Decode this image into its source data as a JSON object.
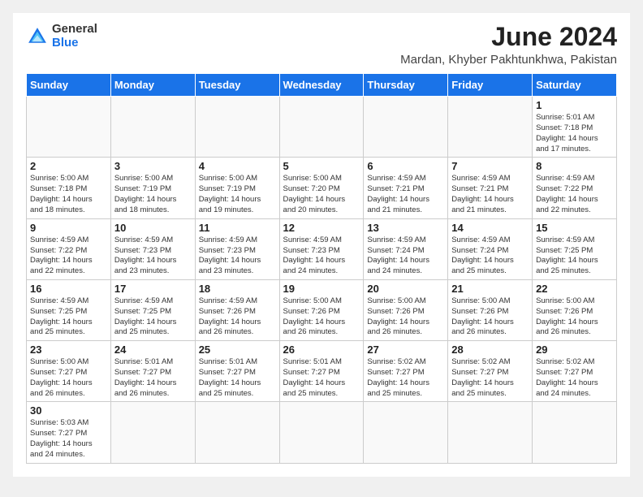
{
  "logo": {
    "line1": "General",
    "line2": "Blue"
  },
  "title": "June 2024",
  "location": "Mardan, Khyber Pakhtunkhwa, Pakistan",
  "weekdays": [
    "Sunday",
    "Monday",
    "Tuesday",
    "Wednesday",
    "Thursday",
    "Friday",
    "Saturday"
  ],
  "weeks": [
    [
      {
        "day": "",
        "info": ""
      },
      {
        "day": "",
        "info": ""
      },
      {
        "day": "",
        "info": ""
      },
      {
        "day": "",
        "info": ""
      },
      {
        "day": "",
        "info": ""
      },
      {
        "day": "",
        "info": ""
      },
      {
        "day": "1",
        "info": "Sunrise: 5:01 AM\nSunset: 7:18 PM\nDaylight: 14 hours\nand 17 minutes."
      }
    ],
    [
      {
        "day": "2",
        "info": "Sunrise: 5:00 AM\nSunset: 7:18 PM\nDaylight: 14 hours\nand 18 minutes."
      },
      {
        "day": "3",
        "info": "Sunrise: 5:00 AM\nSunset: 7:19 PM\nDaylight: 14 hours\nand 18 minutes."
      },
      {
        "day": "4",
        "info": "Sunrise: 5:00 AM\nSunset: 7:19 PM\nDaylight: 14 hours\nand 19 minutes."
      },
      {
        "day": "5",
        "info": "Sunrise: 5:00 AM\nSunset: 7:20 PM\nDaylight: 14 hours\nand 20 minutes."
      },
      {
        "day": "6",
        "info": "Sunrise: 4:59 AM\nSunset: 7:21 PM\nDaylight: 14 hours\nand 21 minutes."
      },
      {
        "day": "7",
        "info": "Sunrise: 4:59 AM\nSunset: 7:21 PM\nDaylight: 14 hours\nand 21 minutes."
      },
      {
        "day": "8",
        "info": "Sunrise: 4:59 AM\nSunset: 7:22 PM\nDaylight: 14 hours\nand 22 minutes."
      }
    ],
    [
      {
        "day": "9",
        "info": "Sunrise: 4:59 AM\nSunset: 7:22 PM\nDaylight: 14 hours\nand 22 minutes."
      },
      {
        "day": "10",
        "info": "Sunrise: 4:59 AM\nSunset: 7:23 PM\nDaylight: 14 hours\nand 23 minutes."
      },
      {
        "day": "11",
        "info": "Sunrise: 4:59 AM\nSunset: 7:23 PM\nDaylight: 14 hours\nand 23 minutes."
      },
      {
        "day": "12",
        "info": "Sunrise: 4:59 AM\nSunset: 7:23 PM\nDaylight: 14 hours\nand 24 minutes."
      },
      {
        "day": "13",
        "info": "Sunrise: 4:59 AM\nSunset: 7:24 PM\nDaylight: 14 hours\nand 24 minutes."
      },
      {
        "day": "14",
        "info": "Sunrise: 4:59 AM\nSunset: 7:24 PM\nDaylight: 14 hours\nand 25 minutes."
      },
      {
        "day": "15",
        "info": "Sunrise: 4:59 AM\nSunset: 7:25 PM\nDaylight: 14 hours\nand 25 minutes."
      }
    ],
    [
      {
        "day": "16",
        "info": "Sunrise: 4:59 AM\nSunset: 7:25 PM\nDaylight: 14 hours\nand 25 minutes."
      },
      {
        "day": "17",
        "info": "Sunrise: 4:59 AM\nSunset: 7:25 PM\nDaylight: 14 hours\nand 25 minutes."
      },
      {
        "day": "18",
        "info": "Sunrise: 4:59 AM\nSunset: 7:26 PM\nDaylight: 14 hours\nand 26 minutes."
      },
      {
        "day": "19",
        "info": "Sunrise: 5:00 AM\nSunset: 7:26 PM\nDaylight: 14 hours\nand 26 minutes."
      },
      {
        "day": "20",
        "info": "Sunrise: 5:00 AM\nSunset: 7:26 PM\nDaylight: 14 hours\nand 26 minutes."
      },
      {
        "day": "21",
        "info": "Sunrise: 5:00 AM\nSunset: 7:26 PM\nDaylight: 14 hours\nand 26 minutes."
      },
      {
        "day": "22",
        "info": "Sunrise: 5:00 AM\nSunset: 7:26 PM\nDaylight: 14 hours\nand 26 minutes."
      }
    ],
    [
      {
        "day": "23",
        "info": "Sunrise: 5:00 AM\nSunset: 7:27 PM\nDaylight: 14 hours\nand 26 minutes."
      },
      {
        "day": "24",
        "info": "Sunrise: 5:01 AM\nSunset: 7:27 PM\nDaylight: 14 hours\nand 26 minutes."
      },
      {
        "day": "25",
        "info": "Sunrise: 5:01 AM\nSunset: 7:27 PM\nDaylight: 14 hours\nand 25 minutes."
      },
      {
        "day": "26",
        "info": "Sunrise: 5:01 AM\nSunset: 7:27 PM\nDaylight: 14 hours\nand 25 minutes."
      },
      {
        "day": "27",
        "info": "Sunrise: 5:02 AM\nSunset: 7:27 PM\nDaylight: 14 hours\nand 25 minutes."
      },
      {
        "day": "28",
        "info": "Sunrise: 5:02 AM\nSunset: 7:27 PM\nDaylight: 14 hours\nand 25 minutes."
      },
      {
        "day": "29",
        "info": "Sunrise: 5:02 AM\nSunset: 7:27 PM\nDaylight: 14 hours\nand 24 minutes."
      }
    ],
    [
      {
        "day": "30",
        "info": "Sunrise: 5:03 AM\nSunset: 7:27 PM\nDaylight: 14 hours\nand 24 minutes."
      },
      {
        "day": "",
        "info": ""
      },
      {
        "day": "",
        "info": ""
      },
      {
        "day": "",
        "info": ""
      },
      {
        "day": "",
        "info": ""
      },
      {
        "day": "",
        "info": ""
      },
      {
        "day": "",
        "info": ""
      }
    ]
  ]
}
